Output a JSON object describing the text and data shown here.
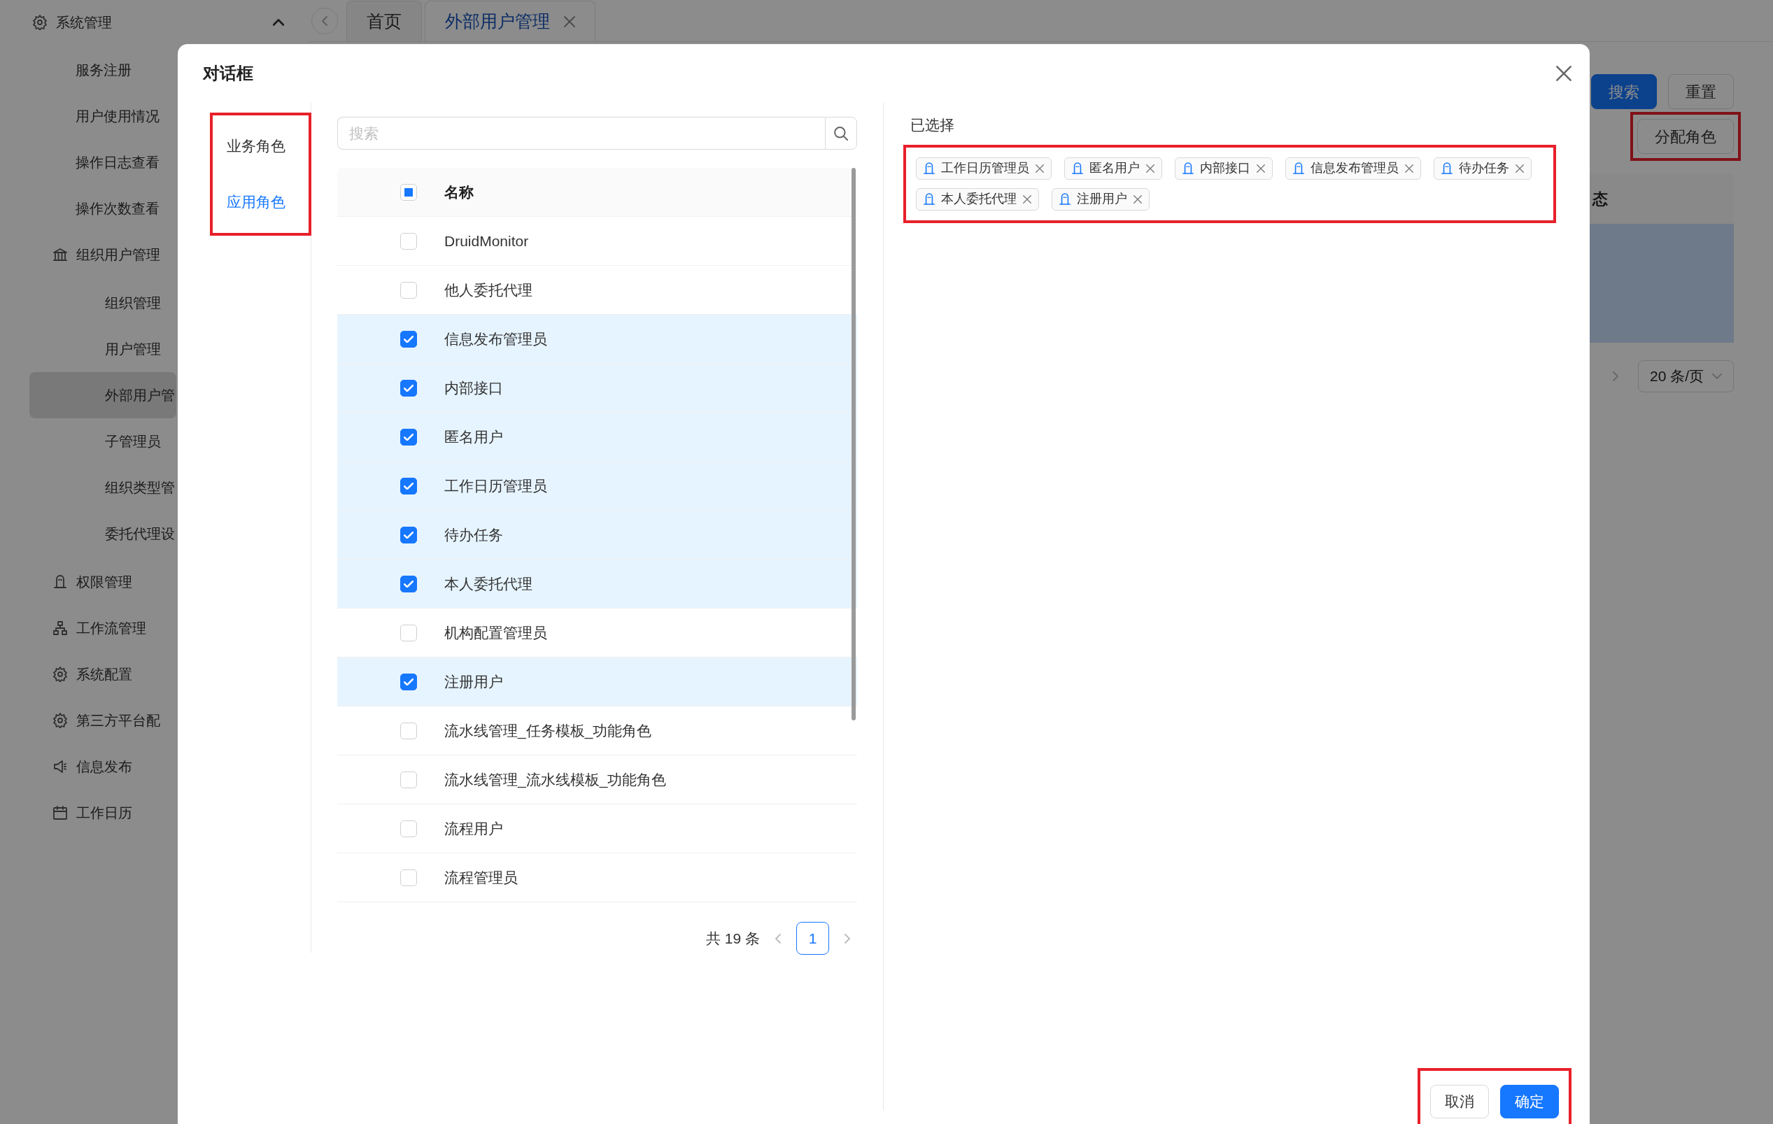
{
  "sidebar": {
    "items": [
      {
        "label": "系统管理",
        "expanded": true,
        "selected": false,
        "children": [
          {
            "label": "服务注册",
            "selected": false
          },
          {
            "label": "用户使用情况",
            "selected": false
          },
          {
            "label": "操作日志查看",
            "selected": false
          },
          {
            "label": "操作次数查看",
            "selected": false
          },
          {
            "label": "组织用户管理",
            "selected": false,
            "children": [
              {
                "label": "组织管理",
                "selected": false
              },
              {
                "label": "用户管理",
                "selected": false
              },
              {
                "label": "外部用户管",
                "selected": true
              },
              {
                "label": "子管理员",
                "selected": false
              },
              {
                "label": "组织类型管",
                "selected": false
              },
              {
                "label": "委托代理设",
                "selected": false
              }
            ]
          },
          {
            "label": "权限管理",
            "selected": false
          },
          {
            "label": "工作流管理",
            "selected": false
          },
          {
            "label": "系统配置",
            "selected": false
          },
          {
            "label": "第三方平台配",
            "selected": false
          },
          {
            "label": "信息发布",
            "selected": false
          },
          {
            "label": "工作日历",
            "selected": false
          }
        ]
      }
    ]
  },
  "tabs": [
    {
      "label": "首页",
      "selected": false,
      "closable": false
    },
    {
      "label": "外部用户管理",
      "selected": true,
      "closable": true
    }
  ],
  "toolbar": {
    "buttons": [
      {
        "label": "搜索",
        "kind": "primary"
      },
      {
        "label": "重置",
        "kind": "default"
      }
    ],
    "assign_button": {
      "label": "分配角色",
      "highlighted": true
    }
  },
  "background_table": {
    "columns": [
      "态"
    ],
    "page_size": "20 条/页"
  },
  "dialog": {
    "title": "对话框",
    "role_tabs": {
      "highlighted": true,
      "items": [
        {
          "label": "业务角色",
          "selected": false
        },
        {
          "label": "应用角色",
          "selected": true
        }
      ]
    },
    "search": {
      "placeholder": "搜索"
    },
    "table": {
      "header_checkbox": {
        "indeterminate": true
      },
      "columns": [
        "名称"
      ],
      "rows": [
        {
          "name": "DruidMonitor",
          "checked": false
        },
        {
          "name": "他人委托代理",
          "checked": false
        },
        {
          "name": "信息发布管理员",
          "checked": true
        },
        {
          "name": "内部接口",
          "checked": true
        },
        {
          "name": "匿名用户",
          "checked": true
        },
        {
          "name": "工作日历管理员",
          "checked": true
        },
        {
          "name": "待办任务",
          "checked": true
        },
        {
          "name": "本人委托代理",
          "checked": true
        },
        {
          "name": "机构配置管理员",
          "checked": false
        },
        {
          "name": "注册用户",
          "checked": true
        },
        {
          "name": "流水线管理_任务模板_功能角色",
          "checked": false
        },
        {
          "name": "流水线管理_流水线模板_功能角色",
          "checked": false
        },
        {
          "name": "流程用户",
          "checked": false
        },
        {
          "name": "流程管理员",
          "checked": false
        }
      ]
    },
    "pagination": {
      "total": "共 19 条",
      "pages": [
        {
          "label": "1",
          "selected": true
        }
      ]
    },
    "selected_panel": {
      "label": "已选择",
      "highlighted": true,
      "tags": [
        "工作日历管理员",
        "匿名用户",
        "内部接口",
        "信息发布管理员",
        "待办任务",
        "本人委托代理",
        "注册用户"
      ]
    },
    "footer": {
      "highlighted": true,
      "buttons": [
        {
          "label": "取消",
          "kind": "default"
        },
        {
          "label": "确定",
          "kind": "primary"
        }
      ]
    }
  }
}
